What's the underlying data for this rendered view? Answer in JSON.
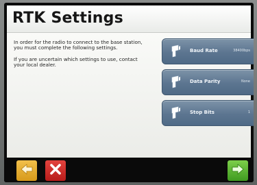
{
  "header": {
    "title": "RTK Settings"
  },
  "instructions": {
    "line1": "In order for the radio to connect to the base station, you must complete the following settings.",
    "line2": "If you are uncertain which settings to use, contact your local dealer."
  },
  "settings": [
    {
      "label": "Baud Rate",
      "value": "38400bps",
      "icon": "radio-icon"
    },
    {
      "label": "Data Parity",
      "value": "None",
      "icon": "radio-icon"
    },
    {
      "label": "Stop Bits",
      "value": "1",
      "icon": "radio-icon"
    }
  ],
  "footer": {
    "back_icon": "arrow-left-icon",
    "cancel_icon": "close-icon",
    "next_icon": "arrow-right-icon"
  },
  "colors": {
    "back": "#e3ad33",
    "cancel": "#cc2b27",
    "next": "#5cb534",
    "setting_button": "#5c7590"
  }
}
